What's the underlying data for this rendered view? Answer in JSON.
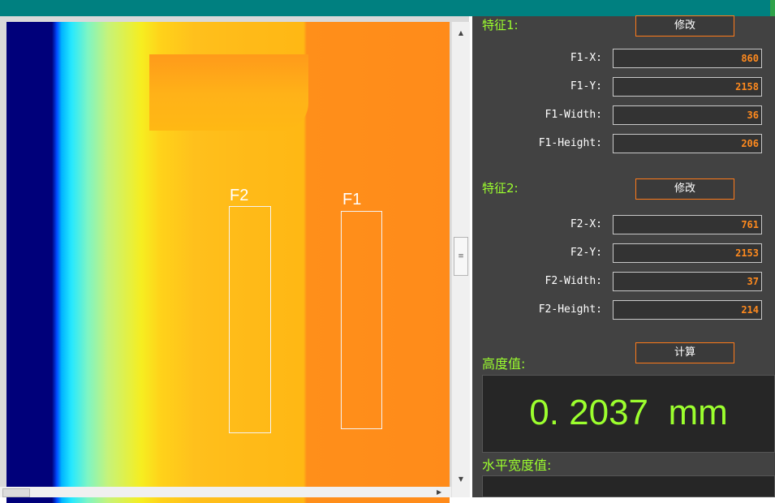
{
  "viewer": {
    "roi_labels": {
      "f1": "F1",
      "f2": "F2"
    },
    "scroll_thumb_glyph": "≡",
    "scroll_up_glyph": "▲",
    "scroll_down_glyph": "▼",
    "scroll_right_glyph": "▶"
  },
  "panel": {
    "feature1": {
      "title": "特征1:",
      "modify_label": "修改",
      "fields": [
        {
          "label": "F1-X:",
          "value": "860"
        },
        {
          "label": "F1-Y:",
          "value": "2158"
        },
        {
          "label": "F1-Width:",
          "value": "36"
        },
        {
          "label": "F1-Height:",
          "value": "206"
        }
      ]
    },
    "feature2": {
      "title": "特征2:",
      "modify_label": "修改",
      "fields": [
        {
          "label": "F2-X:",
          "value": "761"
        },
        {
          "label": "F2-Y:",
          "value": "2153"
        },
        {
          "label": "F2-Width:",
          "value": "37"
        },
        {
          "label": "F2-Height:",
          "value": "214"
        }
      ]
    },
    "calculate_label": "计算",
    "height_title": "高度值:",
    "height_value": "0. 2037  mm",
    "horizontal_width_title": "水平宽度值:",
    "horizontal_width_value": ""
  },
  "colors": {
    "title_bar": "#008080",
    "panel_bg": "#424242",
    "accent_green": "#9cff2e",
    "field_value_orange": "#ff8a1e",
    "button_border": "#ff7b1a"
  }
}
